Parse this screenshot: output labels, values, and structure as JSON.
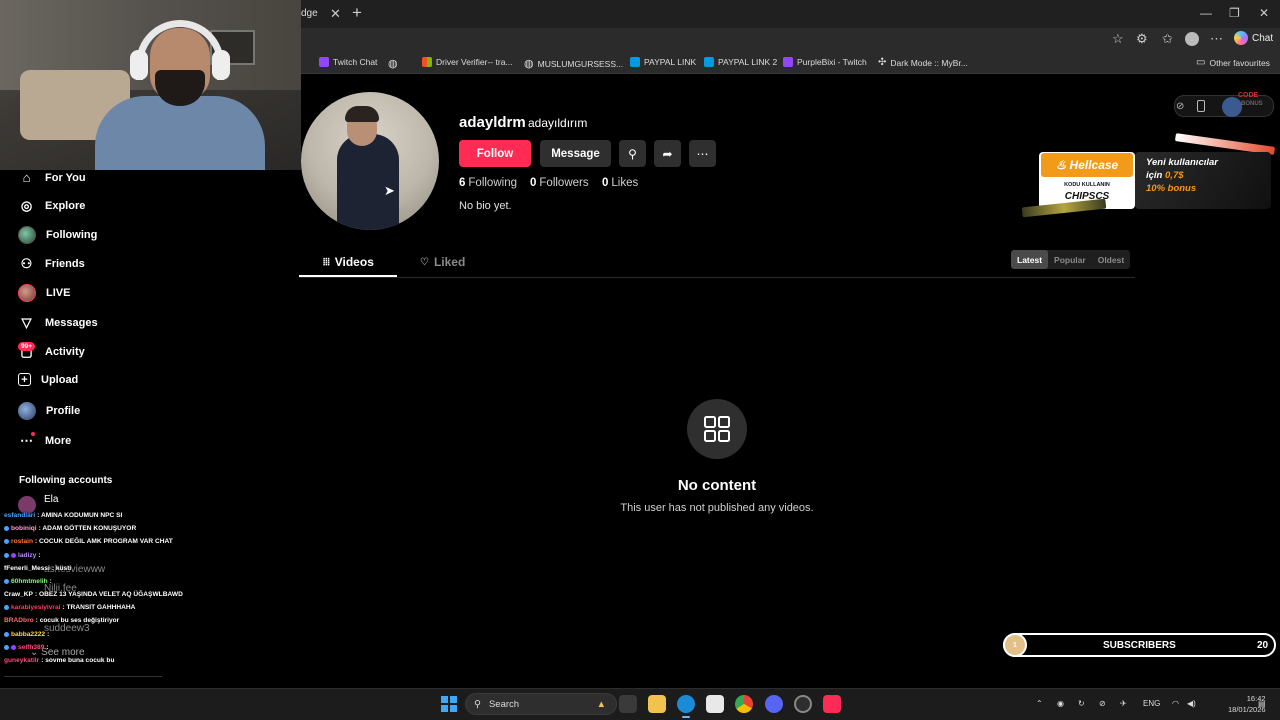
{
  "browser": {
    "tab_fragment": "dge",
    "bookmarks": [
      {
        "label": "Twitch Chat",
        "color": "#9147ff"
      },
      {
        "label": "",
        "color": "#888888"
      },
      {
        "label": "Driver Verifier-- tra...",
        "color": "#f25022"
      },
      {
        "label": "MUSLUMGURSESS...",
        "color": "#888888"
      },
      {
        "label": "PAYPAL LINK",
        "color": "#003087"
      },
      {
        "label": "PAYPAL LINK 2",
        "color": "#003087"
      },
      {
        "label": "PurpleBixi - Twitch",
        "color": "#9147ff"
      },
      {
        "label": "Dark Mode :: MyBr...",
        "color": "#888888"
      }
    ],
    "other_favourites": "Other favourites",
    "chat_label": "Chat"
  },
  "sidebar": {
    "items": [
      {
        "label": "For You",
        "icon": "home-icon"
      },
      {
        "label": "Explore",
        "icon": "compass-icon"
      },
      {
        "label": "Following",
        "icon": "avatar"
      },
      {
        "label": "Friends",
        "icon": "friends-icon"
      },
      {
        "label": "LIVE",
        "icon": "live-avatar"
      },
      {
        "label": "Messages",
        "icon": "messages-icon"
      },
      {
        "label": "Activity",
        "icon": "activity-icon"
      },
      {
        "label": "Upload",
        "icon": "upload-icon"
      },
      {
        "label": "Profile",
        "icon": "profile-avatar"
      },
      {
        "label": "More",
        "icon": "more-icon"
      }
    ],
    "activity_badge": "99+",
    "following_accounts_header": "Following accounts",
    "following_first": "Ela",
    "ghost_names": [
      "ashesviewww",
      "Nilii.fee",
      "suddeew3"
    ],
    "see_more": "See more"
  },
  "chat": [
    {
      "user": "esfandiari",
      "msg": ": AMINA KODUMUN NPC SI",
      "color": "#4aa3ff"
    },
    {
      "user": "bobiniqi",
      "msg": ": ADAM GÖTTEN KONUŞUYOR",
      "color": "#ff9dd6"
    },
    {
      "user": "rostain",
      "msg": ": COCUK DEĞIL AMK PROGRAM VAR CHAT",
      "color": "#ff7b3a"
    },
    {
      "user": "ladizy",
      "msg": ":",
      "color": "#b98aff"
    },
    {
      "user": "fFenerli_Messi",
      "msg": ": küsti",
      "color": "#ffffff"
    },
    {
      "user": "60hmtmelih",
      "msg": ":",
      "color": "#7dff7d"
    },
    {
      "user": "Craw_KP",
      "msg": ": OBEZ 13 YAŞINDA VELET AQ ÜĞAŞWLBAWD",
      "color": "#ffffff"
    },
    {
      "user": "karabiyesiyivrai",
      "msg": ": TRANSIT GAHHHAHA",
      "color": "#ff3b5c"
    },
    {
      "user": "BRADbro",
      "msg": ": cocuk bu ses değiştiriyor",
      "color": "#ff6b6b"
    },
    {
      "user": "babba2222",
      "msg": ":",
      "color": "#ffd84a"
    },
    {
      "user": "selfh389",
      "msg": ":",
      "color": "#ff4a7a"
    },
    {
      "user": "guneykatilr",
      "msg": ": sovme buna cocuk bu",
      "color": "#ff4a7a"
    }
  ],
  "profile": {
    "username": "adayldrm",
    "nickname": "adayıldırım",
    "follow_label": "Follow",
    "message_label": "Message",
    "stats": [
      {
        "value": "6",
        "label": "Following"
      },
      {
        "value": "0",
        "label": "Followers"
      },
      {
        "value": "0",
        "label": "Likes"
      }
    ],
    "bio": "No bio yet.",
    "tabs": [
      "Videos",
      "Liked"
    ],
    "sort": [
      "Latest",
      "Popular",
      "Oldest"
    ],
    "empty_title": "No content",
    "empty_desc": "This user has not published any videos."
  },
  "ad": {
    "brand": "Hellcase",
    "code_label": "KODU KULLANIN",
    "code": "CHIPSCS",
    "line1": "Yeni kullanıcılar",
    "line2_pre": "için",
    "line2_amt": "0,7$",
    "line3": "10% bonus",
    "corner_code": "CODE",
    "corner_bonus": "BONUS"
  },
  "subscribers": {
    "goal_start": "1",
    "label": "SUBSCRIBERS",
    "count": "20"
  },
  "taskbar": {
    "search": "Search",
    "lang": "ENG",
    "time": "16:42",
    "date": "18/01/2026"
  },
  "colors": {
    "accent": "#fe2c55",
    "background": "#000000"
  }
}
